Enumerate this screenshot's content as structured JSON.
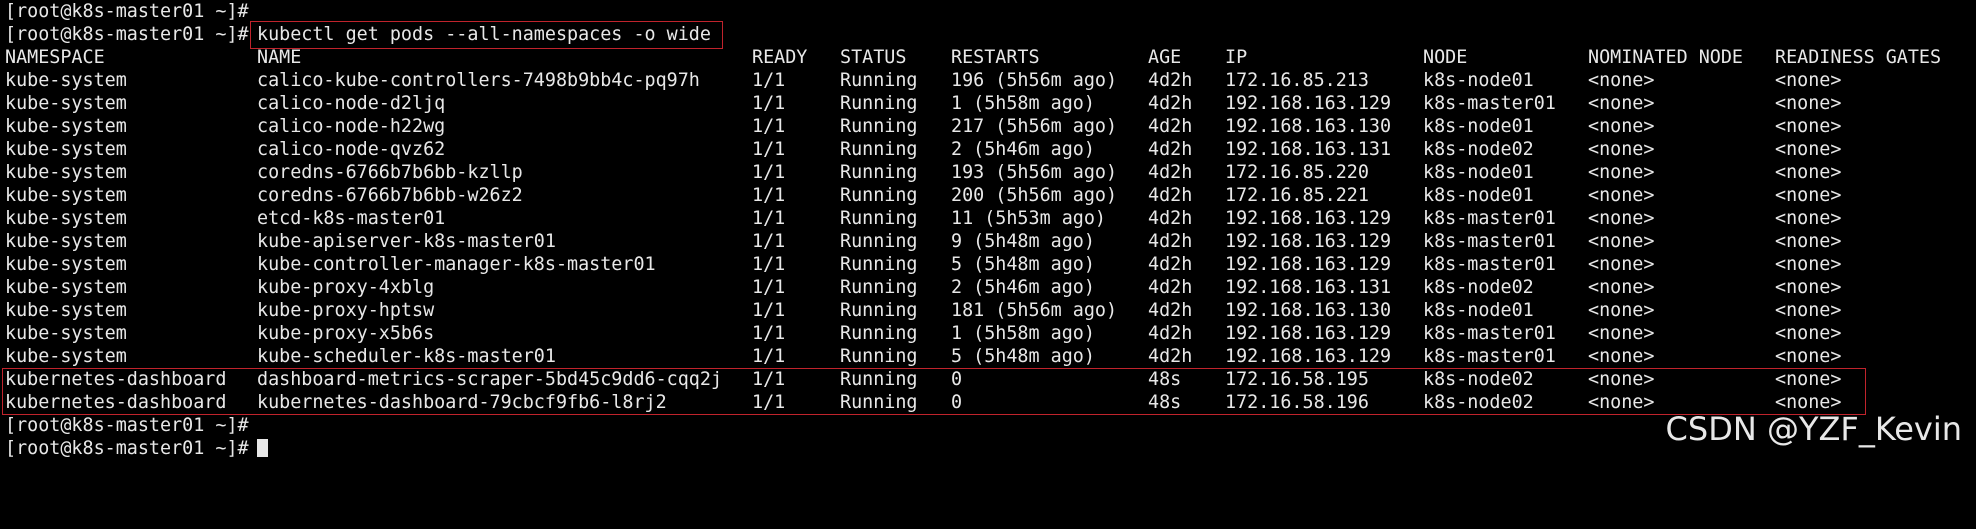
{
  "terminal": {
    "prompt": "[root@k8s-master01 ~]#",
    "command": "kubectl get pods --all-namespaces -o wide",
    "headers": [
      "NAMESPACE",
      "NAME",
      "READY",
      "STATUS",
      "RESTARTS",
      "AGE",
      "IP",
      "NODE",
      "NOMINATED NODE",
      "READINESS GATES"
    ],
    "rows": [
      [
        "kube-system",
        "calico-kube-controllers-7498b9bb4c-pq97h",
        "1/1",
        "Running",
        "196 (5h56m ago)",
        "4d2h",
        "172.16.85.213",
        "k8s-node01",
        "<none>",
        "<none>"
      ],
      [
        "kube-system",
        "calico-node-d2ljq",
        "1/1",
        "Running",
        "1 (5h58m ago)",
        "4d2h",
        "192.168.163.129",
        "k8s-master01",
        "<none>",
        "<none>"
      ],
      [
        "kube-system",
        "calico-node-h22wg",
        "1/1",
        "Running",
        "217 (5h56m ago)",
        "4d2h",
        "192.168.163.130",
        "k8s-node01",
        "<none>",
        "<none>"
      ],
      [
        "kube-system",
        "calico-node-qvz62",
        "1/1",
        "Running",
        "2 (5h46m ago)",
        "4d2h",
        "192.168.163.131",
        "k8s-node02",
        "<none>",
        "<none>"
      ],
      [
        "kube-system",
        "coredns-6766b7b6bb-kzllp",
        "1/1",
        "Running",
        "193 (5h56m ago)",
        "4d2h",
        "172.16.85.220",
        "k8s-node01",
        "<none>",
        "<none>"
      ],
      [
        "kube-system",
        "coredns-6766b7b6bb-w26z2",
        "1/1",
        "Running",
        "200 (5h56m ago)",
        "4d2h",
        "172.16.85.221",
        "k8s-node01",
        "<none>",
        "<none>"
      ],
      [
        "kube-system",
        "etcd-k8s-master01",
        "1/1",
        "Running",
        "11 (5h53m ago)",
        "4d2h",
        "192.168.163.129",
        "k8s-master01",
        "<none>",
        "<none>"
      ],
      [
        "kube-system",
        "kube-apiserver-k8s-master01",
        "1/1",
        "Running",
        "9 (5h48m ago)",
        "4d2h",
        "192.168.163.129",
        "k8s-master01",
        "<none>",
        "<none>"
      ],
      [
        "kube-system",
        "kube-controller-manager-k8s-master01",
        "1/1",
        "Running",
        "5 (5h48m ago)",
        "4d2h",
        "192.168.163.129",
        "k8s-master01",
        "<none>",
        "<none>"
      ],
      [
        "kube-system",
        "kube-proxy-4xblg",
        "1/1",
        "Running",
        "2 (5h46m ago)",
        "4d2h",
        "192.168.163.131",
        "k8s-node02",
        "<none>",
        "<none>"
      ],
      [
        "kube-system",
        "kube-proxy-hptsw",
        "1/1",
        "Running",
        "181 (5h56m ago)",
        "4d2h",
        "192.168.163.130",
        "k8s-node01",
        "<none>",
        "<none>"
      ],
      [
        "kube-system",
        "kube-proxy-x5b6s",
        "1/1",
        "Running",
        "1 (5h58m ago)",
        "4d2h",
        "192.168.163.129",
        "k8s-master01",
        "<none>",
        "<none>"
      ],
      [
        "kube-system",
        "kube-scheduler-k8s-master01",
        "1/1",
        "Running",
        "5 (5h48m ago)",
        "4d2h",
        "192.168.163.129",
        "k8s-master01",
        "<none>",
        "<none>"
      ],
      [
        "kubernetes-dashboard",
        "dashboard-metrics-scraper-5bd45c9dd6-cqq2j",
        "1/1",
        "Running",
        "0",
        "48s",
        "172.16.58.195",
        "k8s-node02",
        "<none>",
        "<none>"
      ],
      [
        "kubernetes-dashboard",
        "kubernetes-dashboard-79cbcf9fb6-l8rj2",
        "1/1",
        "Running",
        "0",
        "48s",
        "172.16.58.196",
        "k8s-node02",
        "<none>",
        "<none>"
      ]
    ]
  },
  "watermark": "CSDN @YZF_Kevin",
  "colors": {
    "background": "#000000",
    "text": "#e8e8e8",
    "highlight": "#c0232c"
  }
}
